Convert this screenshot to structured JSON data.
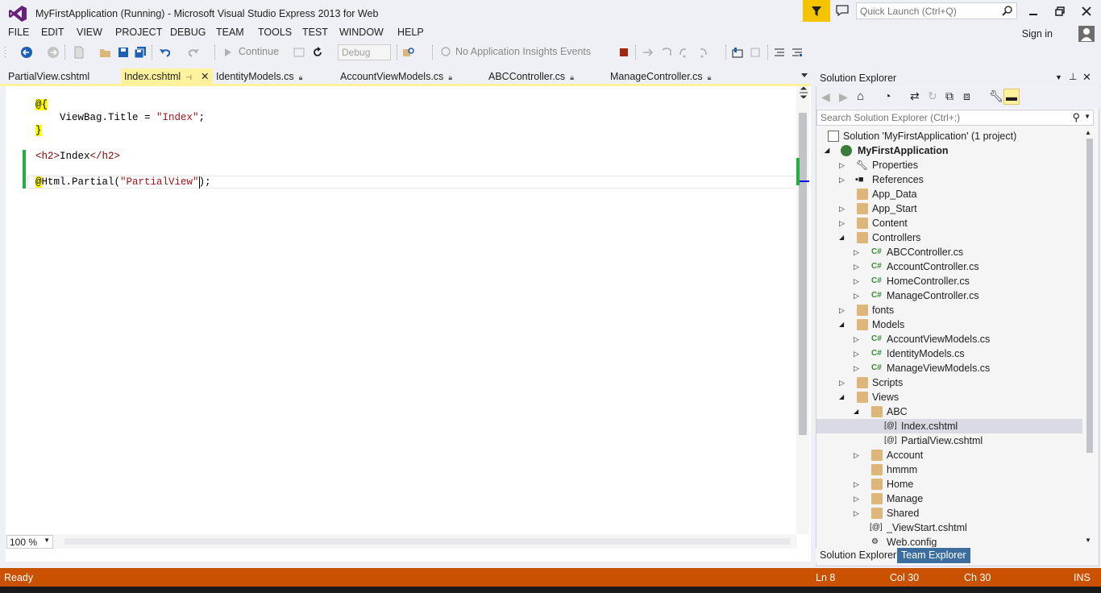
{
  "window": {
    "title": "MyFirstApplication (Running) - Microsoft Visual Studio Express 2013 for Web",
    "quick_launch_placeholder": "Quick Launch (Ctrl+Q)",
    "sign_in": "Sign in"
  },
  "menu": [
    "FILE",
    "EDIT",
    "VIEW",
    "PROJECT",
    "DEBUG",
    "TEAM",
    "TOOLS",
    "TEST",
    "WINDOW",
    "HELP"
  ],
  "toolbar": {
    "continue_label": "Continue",
    "config_value": "Debug",
    "insights_label": "No Application Insights Events"
  },
  "tabs": [
    {
      "label": "PartialView.cshtml",
      "active": false
    },
    {
      "label": "Index.cshtml",
      "active": true
    },
    {
      "label": "IdentityModels.cs",
      "active": false
    },
    {
      "label": "AccountViewModels.cs",
      "active": false
    },
    {
      "label": "ABCController.cs",
      "active": false
    },
    {
      "label": "ManageController.cs",
      "active": false
    }
  ],
  "editor": {
    "lines": {
      "l1_razor": "@{",
      "l2_prefix": "    ViewBag.Title = ",
      "l2_string": "\"Index\"",
      "l2_suffix": ";",
      "l3_razor": "}",
      "l5_open": "<h2>",
      "l5_text": "Index",
      "l5_close": "</h2>",
      "l7_razor": "@",
      "l7_code": "Html.Partial(",
      "l7_string": "\"PartialView\"",
      "l7_suffix": ");"
    },
    "zoom": "100 %"
  },
  "solution_explorer": {
    "title": "Solution Explorer",
    "search_placeholder": "Search Solution Explorer (Ctrl+;)",
    "nodes": [
      {
        "label": "Solution 'MyFirstApplication' (1 project)",
        "icon": "solution-icon"
      },
      {
        "label": "MyFirstApplication",
        "icon": "web-project-icon"
      },
      {
        "label": "Properties",
        "icon": "wrench-icon"
      },
      {
        "label": "References",
        "icon": "references-icon"
      },
      {
        "label": "App_Data",
        "icon": "folder-icon"
      },
      {
        "label": "App_Start",
        "icon": "folder-icon"
      },
      {
        "label": "Content",
        "icon": "folder-icon"
      },
      {
        "label": "Controllers",
        "icon": "folder-icon"
      },
      {
        "label": "ABCController.cs",
        "icon": "csharp-icon"
      },
      {
        "label": "AccountController.cs",
        "icon": "csharp-icon"
      },
      {
        "label": "HomeController.cs",
        "icon": "csharp-icon"
      },
      {
        "label": "ManageController.cs",
        "icon": "csharp-icon"
      },
      {
        "label": "fonts",
        "icon": "folder-icon"
      },
      {
        "label": "Models",
        "icon": "folder-icon"
      },
      {
        "label": "AccountViewModels.cs",
        "icon": "csharp-icon"
      },
      {
        "label": "IdentityModels.cs",
        "icon": "csharp-icon"
      },
      {
        "label": "ManageViewModels.cs",
        "icon": "csharp-icon"
      },
      {
        "label": "Scripts",
        "icon": "folder-icon"
      },
      {
        "label": "Views",
        "icon": "folder-icon"
      },
      {
        "label": "ABC",
        "icon": "folder-icon"
      },
      {
        "label": "Index.cshtml",
        "icon": "razor-icon"
      },
      {
        "label": "PartialView.cshtml",
        "icon": "razor-icon"
      },
      {
        "label": "Account",
        "icon": "folder-icon"
      },
      {
        "label": "hmmm",
        "icon": "folder-icon"
      },
      {
        "label": "Home",
        "icon": "folder-icon"
      },
      {
        "label": "Manage",
        "icon": "folder-icon"
      },
      {
        "label": "Shared",
        "icon": "folder-icon"
      },
      {
        "label": "_ViewStart.cshtml",
        "icon": "razor-icon"
      },
      {
        "label": "Web.config",
        "icon": "config-icon"
      }
    ],
    "bottom_tabs": [
      "Solution Explorer",
      "Team Explorer"
    ]
  },
  "status": {
    "state": "Ready",
    "line": "Ln 8",
    "col": "Col 30",
    "ch": "Ch 30",
    "mode": "INS"
  },
  "colors": {
    "accent_status": "#ca5100",
    "active_tab": "#fff29d",
    "notification": "#f5c400"
  }
}
